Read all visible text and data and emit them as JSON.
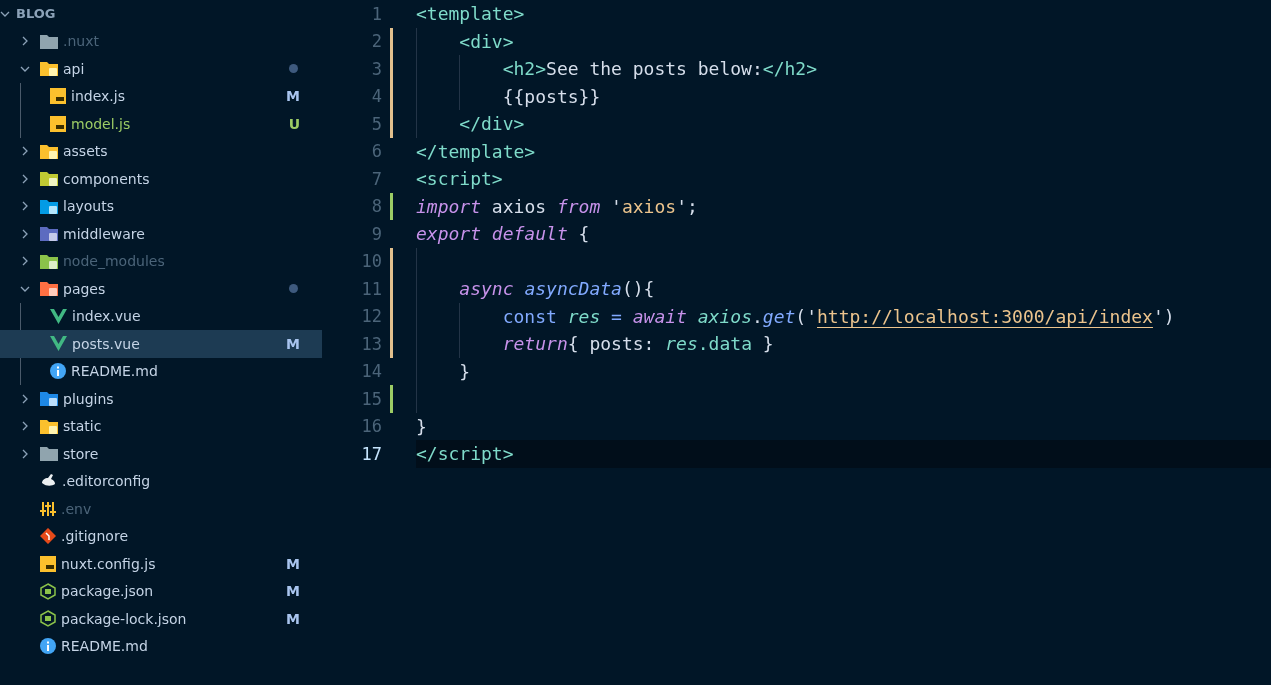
{
  "explorer": {
    "title": "BLOG",
    "expanded": true,
    "items": [
      {
        "name": ".nuxt",
        "kind": "folder-grey",
        "expanded": false,
        "dimmed": true,
        "untracked": false
      },
      {
        "name": "api",
        "kind": "folder-api",
        "expanded": true,
        "dimmed": false,
        "untracked": false,
        "dot": true,
        "children": [
          {
            "name": "index.js",
            "kind": "js",
            "dimmed": false,
            "untracked": false,
            "badge": "M",
            "selected": false
          },
          {
            "name": "model.js",
            "kind": "js",
            "dimmed": false,
            "untracked": true,
            "badge": "U",
            "selected": false
          }
        ]
      },
      {
        "name": "assets",
        "kind": "folder-assets",
        "expanded": false,
        "dimmed": false,
        "untracked": false
      },
      {
        "name": "components",
        "kind": "folder-components",
        "expanded": false,
        "dimmed": false,
        "untracked": false
      },
      {
        "name": "layouts",
        "kind": "folder-layouts",
        "expanded": false,
        "dimmed": false,
        "untracked": false
      },
      {
        "name": "middleware",
        "kind": "folder-middleware",
        "expanded": false,
        "dimmed": false,
        "untracked": false
      },
      {
        "name": "node_modules",
        "kind": "folder-node",
        "expanded": false,
        "dimmed": true,
        "untracked": false
      },
      {
        "name": "pages",
        "kind": "folder-pages",
        "expanded": true,
        "dimmed": false,
        "untracked": false,
        "dot": true,
        "children": [
          {
            "name": "index.vue",
            "kind": "vue",
            "dimmed": false,
            "untracked": false,
            "selected": false
          },
          {
            "name": "posts.vue",
            "kind": "vue",
            "dimmed": false,
            "untracked": false,
            "badge": "M",
            "selected": true
          },
          {
            "name": "README.md",
            "kind": "info",
            "dimmed": false,
            "untracked": false,
            "selected": false
          }
        ]
      },
      {
        "name": "plugins",
        "kind": "folder-plugins",
        "expanded": false,
        "dimmed": false,
        "untracked": false
      },
      {
        "name": "static",
        "kind": "folder-assets",
        "expanded": false,
        "dimmed": false,
        "untracked": false
      },
      {
        "name": "store",
        "kind": "folder-grey",
        "expanded": false,
        "dimmed": false,
        "untracked": false
      },
      {
        "name": ".editorconfig",
        "kind": "editorconfig",
        "dimmed": false,
        "untracked": false,
        "selected": false
      },
      {
        "name": ".env",
        "kind": "env",
        "dimmed": true,
        "untracked": false,
        "selected": false
      },
      {
        "name": ".gitignore",
        "kind": "git",
        "dimmed": false,
        "untracked": false,
        "selected": false
      },
      {
        "name": "nuxt.config.js",
        "kind": "js",
        "dimmed": false,
        "untracked": false,
        "badge": "M",
        "selected": false
      },
      {
        "name": "package.json",
        "kind": "node-js",
        "dimmed": false,
        "untracked": false,
        "badge": "M",
        "selected": false
      },
      {
        "name": "package-lock.json",
        "kind": "node-js",
        "dimmed": false,
        "untracked": false,
        "badge": "M",
        "selected": false
      },
      {
        "name": "README.md",
        "kind": "info",
        "dimmed": false,
        "untracked": false,
        "selected": false
      }
    ]
  },
  "editor": {
    "lines": [
      {
        "number": "1",
        "kind": "plain",
        "current": false,
        "tokens": [
          {
            "text": "<template>",
            "kind": "tag"
          }
        ]
      },
      {
        "number": "2",
        "kind": "modified",
        "current": false,
        "tokens": [
          {
            "text": "    <div>",
            "kind": "tag"
          }
        ]
      },
      {
        "number": "3",
        "kind": "modified",
        "current": false,
        "tokens": [
          {
            "text": "        <h2>",
            "kind": "tag"
          },
          {
            "text": "See the posts below:",
            "kind": "text"
          },
          {
            "text": "</h2>",
            "kind": "tag"
          }
        ]
      },
      {
        "number": "4",
        "kind": "modified",
        "current": false,
        "tokens": [
          {
            "text": "        {{posts}}",
            "kind": "text"
          }
        ]
      },
      {
        "number": "5",
        "kind": "modified",
        "current": false,
        "tokens": [
          {
            "text": "    </div>",
            "kind": "tag"
          }
        ]
      },
      {
        "number": "6",
        "kind": "plain",
        "current": false,
        "tokens": [
          {
            "text": "</template>",
            "kind": "tag"
          }
        ]
      },
      {
        "number": "7",
        "kind": "plain",
        "current": false,
        "tokens": [
          {
            "text": "<script>",
            "kind": "tag"
          }
        ]
      },
      {
        "number": "8",
        "kind": "added",
        "current": false,
        "tokens": [
          {
            "text": "import",
            "kind": "keyword"
          },
          {
            "text": " axios ",
            "kind": "text"
          },
          {
            "text": "from",
            "kind": "keyword"
          },
          {
            "text": " '",
            "kind": "text"
          },
          {
            "text": "axios",
            "kind": "string"
          },
          {
            "text": "';",
            "kind": "text"
          }
        ]
      },
      {
        "number": "9",
        "kind": "plain",
        "current": false,
        "tokens": [
          {
            "text": "export default",
            "kind": "keyword"
          },
          {
            "text": " {",
            "kind": "text"
          }
        ]
      },
      {
        "number": "10",
        "kind": "modified",
        "current": false
      },
      {
        "number": "11",
        "kind": "modified",
        "current": false,
        "tokens": [
          {
            "text": "    async ",
            "kind": "keyword"
          },
          {
            "text": "asyncData",
            "kind": "func"
          },
          {
            "text": "(){",
            "kind": "text"
          }
        ]
      },
      {
        "number": "12",
        "kind": "modified",
        "current": false,
        "tokens": [
          {
            "text": "        const ",
            "kind": "storage"
          },
          {
            "text": "res",
            "kind": "var"
          },
          {
            "text": " = ",
            "kind": "storage"
          },
          {
            "text": "await ",
            "kind": "keyword"
          },
          {
            "text": "axios",
            "kind": "var"
          },
          {
            "text": ".",
            "kind": "text"
          },
          {
            "text": "get",
            "kind": "func"
          },
          {
            "text": "('",
            "kind": "text"
          },
          {
            "text": "http://localhost:3000/api/index",
            "kind": "link"
          },
          {
            "text": "')",
            "kind": "text"
          }
        ]
      },
      {
        "number": "13",
        "kind": "modified",
        "current": false,
        "tokens": [
          {
            "text": "        return",
            "kind": "keyword"
          },
          {
            "text": "{ posts: ",
            "kind": "text"
          },
          {
            "text": "res",
            "kind": "var"
          },
          {
            "text": ".data",
            "kind": "prop"
          },
          {
            "text": " }",
            "kind": "text"
          }
        ]
      },
      {
        "number": "14",
        "kind": "plain",
        "current": false,
        "tokens": [
          {
            "text": "    }",
            "kind": "text"
          }
        ]
      },
      {
        "number": "15",
        "kind": "added",
        "current": false
      },
      {
        "number": "16",
        "kind": "plain",
        "current": false,
        "tokens": [
          {
            "text": "}",
            "kind": "text"
          }
        ]
      },
      {
        "number": "17",
        "kind": "plain",
        "current": true,
        "tokens": [
          {
            "text": "</script>",
            "kind": "tag"
          }
        ]
      }
    ]
  }
}
